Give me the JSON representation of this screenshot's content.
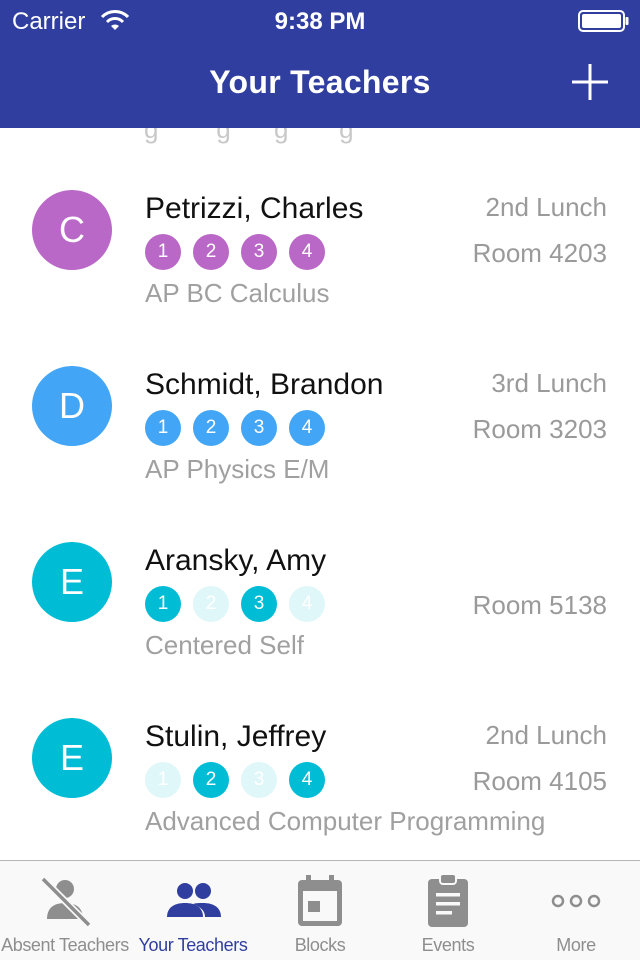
{
  "status_bar": {
    "carrier": "Carrier",
    "time": "9:38 PM"
  },
  "header": {
    "title": "Your Teachers"
  },
  "colors": {
    "header": "#303F9F",
    "purple": "#BA68C8",
    "blue": "#42A5F5",
    "cyan": "#00BCD4",
    "cyan_faded": "#E0F7FA"
  },
  "teachers": [
    {
      "initial": "C",
      "name": "Petrizzi, Charles",
      "course": "AP BC Calculus",
      "lunch": "2nd Lunch",
      "room": "Room 4203",
      "color": "#BA68C8",
      "blocks": [
        {
          "label": "1",
          "active": true
        },
        {
          "label": "2",
          "active": true
        },
        {
          "label": "3",
          "active": true
        },
        {
          "label": "4",
          "active": true
        }
      ]
    },
    {
      "initial": "D",
      "name": "Schmidt, Brandon",
      "course": "AP Physics E/M",
      "lunch": "3rd Lunch",
      "room": "Room 3203",
      "color": "#42A5F5",
      "blocks": [
        {
          "label": "1",
          "active": true
        },
        {
          "label": "2",
          "active": true
        },
        {
          "label": "3",
          "active": true
        },
        {
          "label": "4",
          "active": true
        }
      ]
    },
    {
      "initial": "E",
      "name": "Aransky, Amy",
      "course": "Centered Self",
      "lunch": "",
      "room": "Room 5138",
      "color": "#00BCD4",
      "blocks": [
        {
          "label": "1",
          "active": true
        },
        {
          "label": "2",
          "active": false
        },
        {
          "label": "3",
          "active": true
        },
        {
          "label": "4",
          "active": false
        }
      ]
    },
    {
      "initial": "E",
      "name": "Stulin, Jeffrey",
      "course": "Advanced Computer Programming",
      "lunch": "2nd Lunch",
      "room": "Room 4105",
      "color": "#00BCD4",
      "blocks": [
        {
          "label": "1",
          "active": false
        },
        {
          "label": "2",
          "active": true
        },
        {
          "label": "3",
          "active": false
        },
        {
          "label": "4",
          "active": true
        }
      ]
    }
  ],
  "tabs": [
    {
      "label": "Absent Teachers",
      "icon": "absent-teachers-icon",
      "active": false
    },
    {
      "label": "Your Teachers",
      "icon": "people-icon",
      "active": true
    },
    {
      "label": "Blocks",
      "icon": "calendar-icon",
      "active": false
    },
    {
      "label": "Events",
      "icon": "clipboard-icon",
      "active": false
    },
    {
      "label": "More",
      "icon": "more-dots-icon",
      "active": false
    }
  ]
}
